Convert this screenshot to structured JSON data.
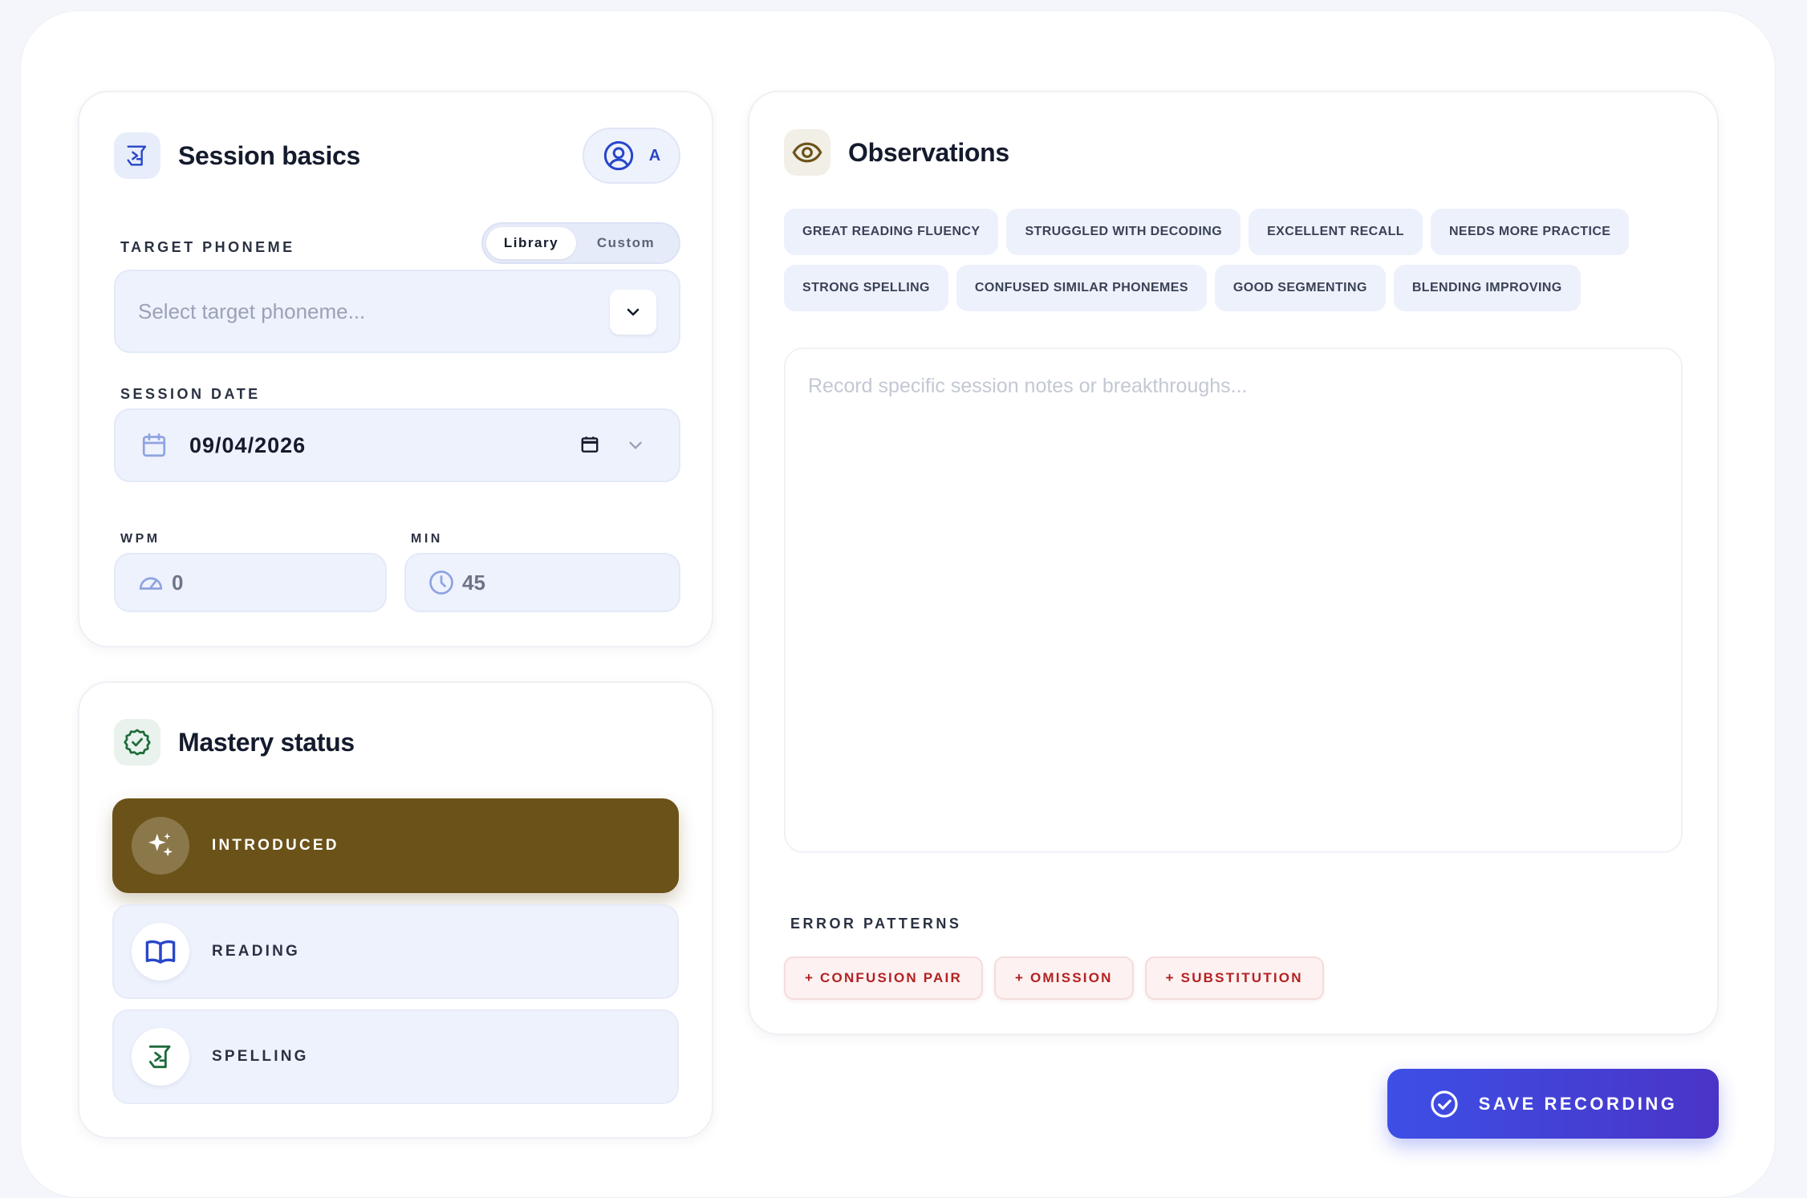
{
  "session_basics": {
    "title": "Session basics",
    "student_badge": "A",
    "target_phoneme_label": "TARGET PHONEME",
    "toggle": {
      "library": "Library",
      "custom": "Custom",
      "selected": "Library"
    },
    "phoneme_placeholder": "Select target phoneme...",
    "session_date_label": "SESSION DATE",
    "session_date_value": "09/04/2026",
    "wpm_label": "WPM",
    "wpm_value": "0",
    "min_label": "MIN",
    "min_value": "45"
  },
  "mastery": {
    "title": "Mastery status",
    "options": [
      {
        "label": "INTRODUCED",
        "icon": "sparkles-icon",
        "active": true
      },
      {
        "label": "READING",
        "icon": "book-open-icon",
        "active": false
      },
      {
        "label": "SPELLING",
        "icon": "spelling-icon",
        "active": false
      }
    ]
  },
  "observations": {
    "title": "Observations",
    "tags": [
      "GREAT READING FLUENCY",
      "STRUGGLED WITH DECODING",
      "EXCELLENT RECALL",
      "NEEDS MORE PRACTICE",
      "STRONG SPELLING",
      "CONFUSED SIMILAR PHONEMES",
      "GOOD SEGMENTING",
      "BLENDING IMPROVING"
    ],
    "notes_placeholder": "Record specific session notes or breakthroughs...",
    "error_patterns_label": "ERROR PATTERNS",
    "error_patterns": [
      "+ CONFUSION PAIR",
      "+ OMISSION",
      "+ SUBSTITUTION"
    ]
  },
  "save_button_label": "SAVE RECORDING",
  "colors": {
    "accent_blue": "#3d4fe6",
    "mastery_active": "#6b5218",
    "error_red": "#b32222",
    "field_bg": "#eef2fd"
  }
}
